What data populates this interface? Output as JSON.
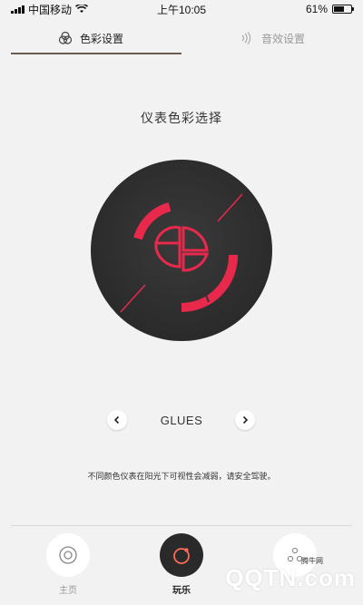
{
  "status_bar": {
    "carrier": "中国移动",
    "time": "上午10:05",
    "battery_text": "61%",
    "battery_level": 0.61
  },
  "tabs": [
    {
      "label": "色彩设置",
      "icon": "color-circles-icon",
      "active": true
    },
    {
      "label": "音效设置",
      "icon": "sound-wave-icon",
      "active": false
    }
  ],
  "page": {
    "title": "仪表色彩选择",
    "theme_name": "GLUES",
    "warning": "不同颜色仪表在阳光下可视性会减弱，请安全驾驶。"
  },
  "gauge": {
    "accent_color": "#e8294b",
    "dial_color": "#333334"
  },
  "bottom_nav": [
    {
      "label": "主页",
      "icon": "target-icon",
      "active": false
    },
    {
      "label": "玩乐",
      "icon": "ring-dot-icon",
      "active": true
    },
    {
      "label": "",
      "icon": "three-dots-icon",
      "active": false
    }
  ],
  "watermark": {
    "small_text": "腾牛网",
    "large_text": "QQTN.com"
  }
}
